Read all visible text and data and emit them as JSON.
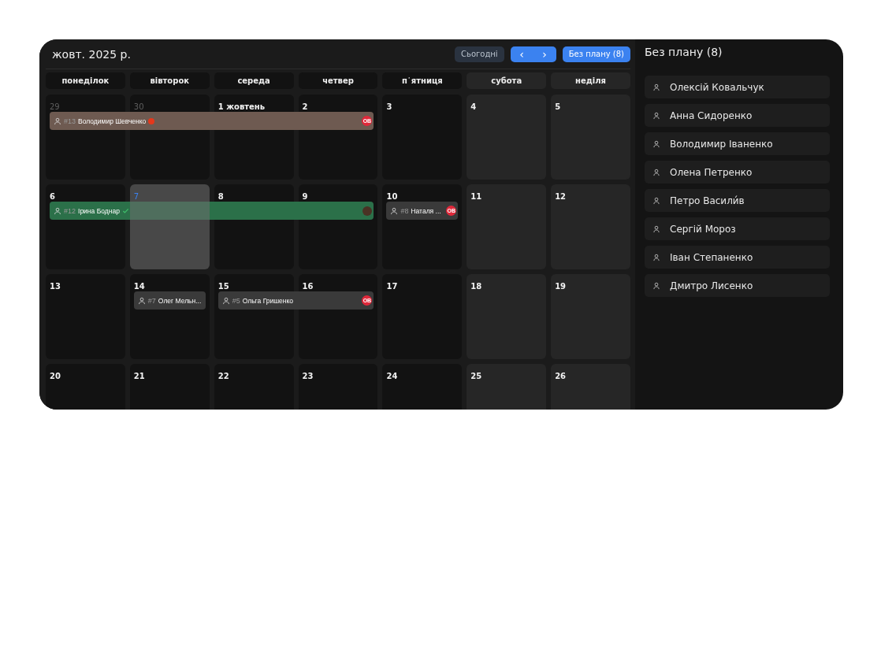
{
  "header": {
    "title": "жовт. 2025 р.",
    "today_button": "Сьогодні",
    "prev_button": "‹",
    "next_button": "›",
    "unplanned_button": "Без плану (8)"
  },
  "weekdays": [
    {
      "label": "понеділок",
      "weekend": false
    },
    {
      "label": "вівторок",
      "weekend": false
    },
    {
      "label": "середа",
      "weekend": false
    },
    {
      "label": "четвер",
      "weekend": false
    },
    {
      "label": "п᾽ятниця",
      "weekend": false
    },
    {
      "label": "субота",
      "weekend": true
    },
    {
      "label": "неділя",
      "weekend": true
    }
  ],
  "weeks": [
    {
      "days": [
        {
          "label": "29",
          "other_month": true,
          "today": false,
          "event": {
            "number": "#13",
            "name": "Володимир Шевченко",
            "color": "#6e5a51",
            "flagged": true,
            "confirmed": false,
            "avatar": {
              "kind": "initials",
              "text": "ОВ"
            }
          }
        },
        {
          "label": "30",
          "other_month": true,
          "today": false,
          "continued": true
        },
        {
          "label": "1 жовтень",
          "other_month": false,
          "today": false,
          "continued": true
        },
        {
          "label": "2",
          "other_month": false,
          "today": false,
          "continued": true
        },
        {
          "label": "3",
          "other_month": false,
          "today": false
        },
        {
          "label": "4",
          "other_month": false,
          "today": false
        },
        {
          "label": "5",
          "other_month": false,
          "today": false
        }
      ]
    },
    {
      "days": [
        {
          "label": "6",
          "other_month": false,
          "today": false,
          "event": {
            "number": "#12",
            "name": "Ірина Боднар",
            "color": "#2b7049",
            "flagged": false,
            "confirmed": true,
            "avatar": {
              "kind": "photo"
            }
          }
        },
        {
          "label": "7",
          "other_month": false,
          "today": true,
          "continued": true
        },
        {
          "label": "8",
          "other_month": false,
          "today": false,
          "continued": true
        },
        {
          "label": "9",
          "other_month": false,
          "today": false,
          "continued": true
        },
        {
          "label": "10",
          "other_month": false,
          "today": false,
          "event": {
            "number": "#8",
            "name": "Наталя ...",
            "color": "#3a3a3a",
            "flagged": false,
            "confirmed": false,
            "avatar": {
              "kind": "initials",
              "text": "ОВ"
            }
          }
        },
        {
          "label": "11",
          "other_month": false,
          "today": false
        },
        {
          "label": "12",
          "other_month": false,
          "today": false
        }
      ]
    },
    {
      "days": [
        {
          "label": "13",
          "other_month": false,
          "today": false
        },
        {
          "label": "14",
          "other_month": false,
          "today": false,
          "event": {
            "number": "#7",
            "name": "Олег Мельн...",
            "color": "#3a3a3a",
            "flagged": false,
            "confirmed": false,
            "avatar": {
              "kind": "none"
            }
          }
        },
        {
          "label": "15",
          "other_month": false,
          "today": false,
          "event": {
            "number": "#5",
            "name": "Ольга Гришенко",
            "color": "#3a3a3a",
            "flagged": false,
            "confirmed": false,
            "avatar": {
              "kind": "initials",
              "text": "ОВ"
            }
          }
        },
        {
          "label": "16",
          "other_month": false,
          "today": false,
          "continued": true
        },
        {
          "label": "17",
          "other_month": false,
          "today": false
        },
        {
          "label": "18",
          "other_month": false,
          "today": false
        },
        {
          "label": "19",
          "other_month": false,
          "today": false
        }
      ]
    },
    {
      "days": [
        {
          "label": "20",
          "other_month": false,
          "today": false
        },
        {
          "label": "21",
          "other_month": false,
          "today": false
        },
        {
          "label": "22",
          "other_month": false,
          "today": false
        },
        {
          "label": "23",
          "other_month": false,
          "today": false
        },
        {
          "label": "24",
          "other_month": false,
          "today": false
        },
        {
          "label": "25",
          "other_month": false,
          "today": false
        },
        {
          "label": "26",
          "other_month": false,
          "today": false
        }
      ]
    }
  ],
  "sidebar": {
    "title": "Без плану (8)",
    "items": [
      "Олексій Ковальчук",
      "Анна Сидоренко",
      "Володимир Іваненко",
      "Олена Петренко",
      "Петро Васили́в",
      "Сергій Мороз",
      "Іван Степаненко",
      "Дмитро Лисенко"
    ]
  }
}
